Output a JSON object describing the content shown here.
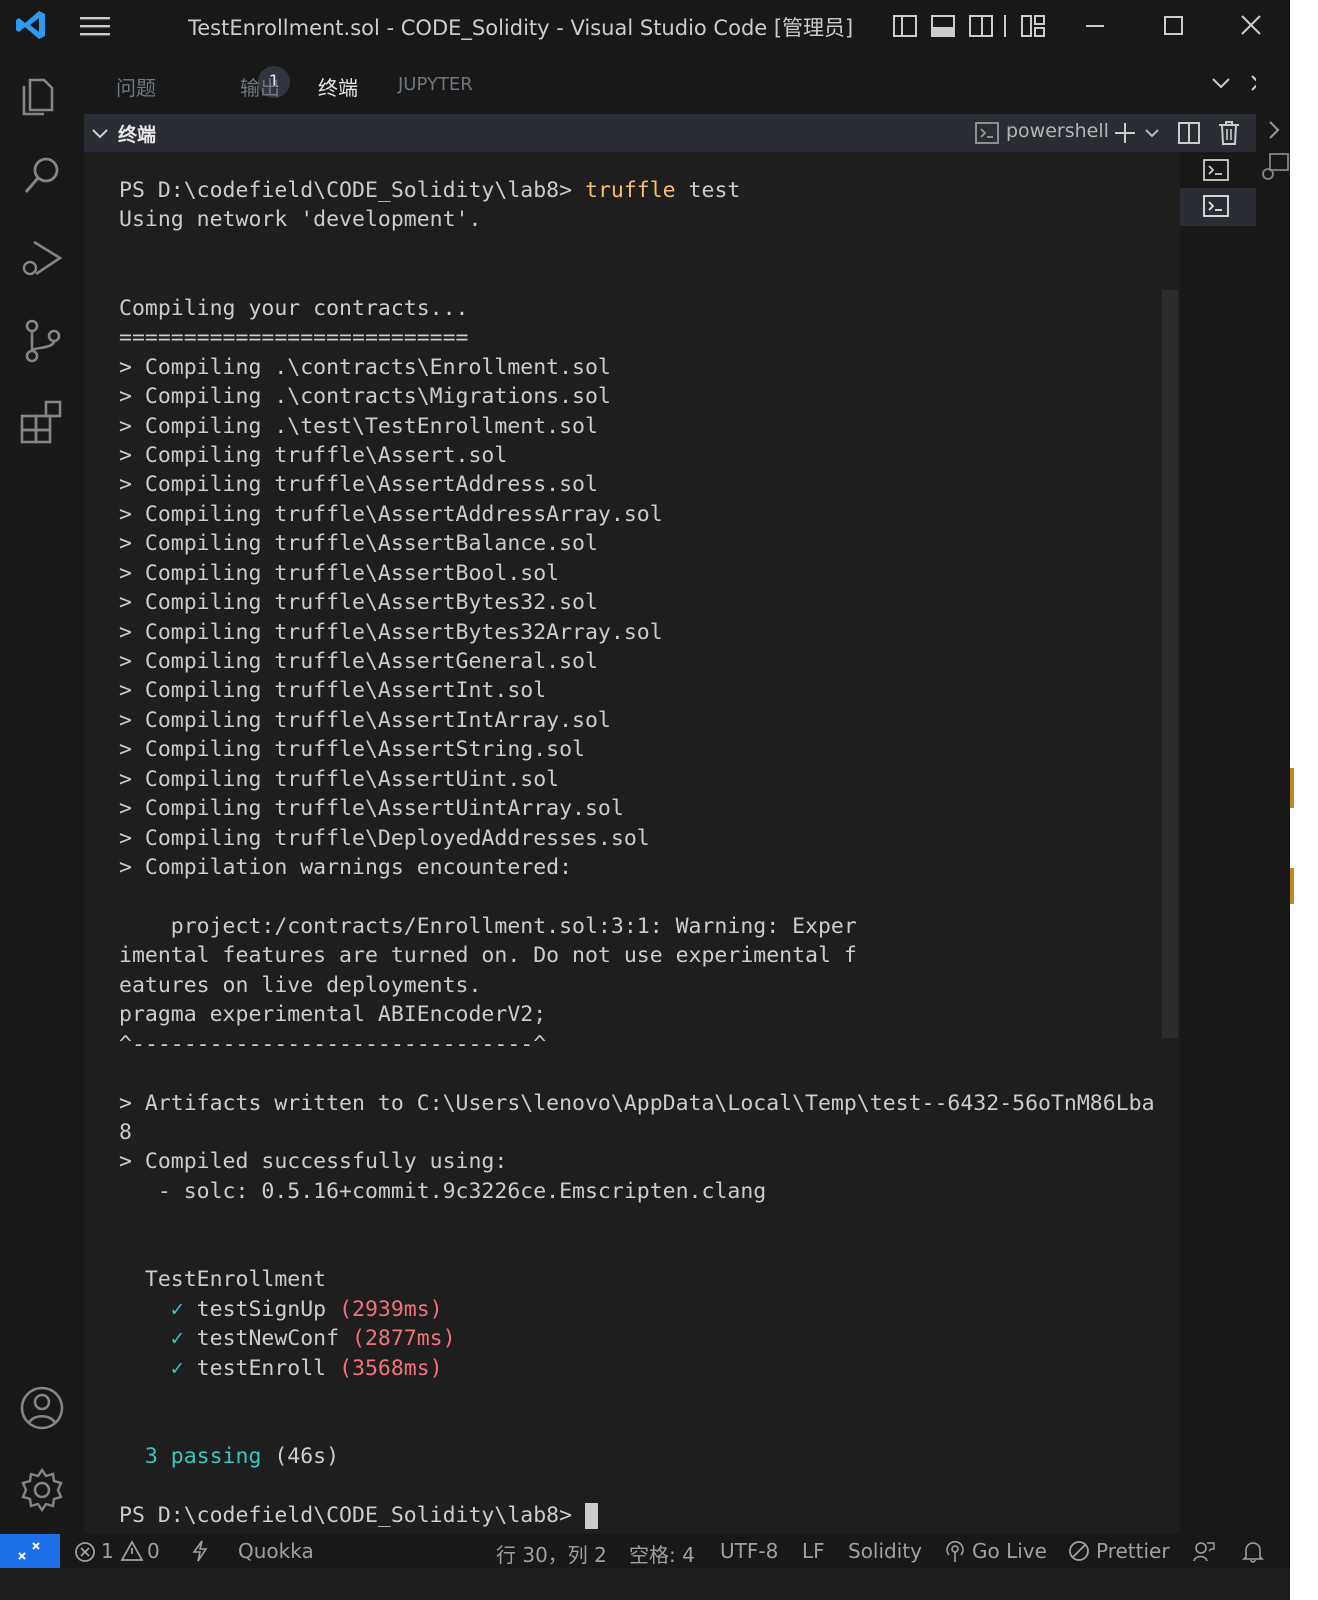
{
  "window": {
    "title": "TestEnrollment.sol - CODE_Solidity - Visual Studio Code [管理员]"
  },
  "panel": {
    "tabs": [
      {
        "label": "问题",
        "badge": "1"
      },
      {
        "label": "输出"
      },
      {
        "label": "终端"
      },
      {
        "label": "JUPYTER"
      }
    ],
    "active_tab": "终端"
  },
  "terminal_header": {
    "title": "终端",
    "shell": "powershell"
  },
  "terminal": {
    "lines": [
      {
        "segments": [
          {
            "t": "PS D:\\codefield\\CODE_Solidity\\lab8> "
          },
          {
            "t": "truffle",
            "c": "y"
          },
          {
            "t": " test"
          }
        ]
      },
      {
        "segments": [
          {
            "t": "Using network 'development'."
          }
        ]
      },
      {
        "segments": [
          {
            "t": ""
          }
        ]
      },
      {
        "segments": [
          {
            "t": ""
          }
        ]
      },
      {
        "segments": [
          {
            "t": "Compiling your contracts..."
          }
        ]
      },
      {
        "segments": [
          {
            "t": "==========================="
          }
        ]
      },
      {
        "segments": [
          {
            "t": "> Compiling .\\contracts\\Enrollment.sol"
          }
        ]
      },
      {
        "segments": [
          {
            "t": "> Compiling .\\contracts\\Migrations.sol"
          }
        ]
      },
      {
        "segments": [
          {
            "t": "> Compiling .\\test\\TestEnrollment.sol"
          }
        ]
      },
      {
        "segments": [
          {
            "t": "> Compiling truffle\\Assert.sol"
          }
        ]
      },
      {
        "segments": [
          {
            "t": "> Compiling truffle\\AssertAddress.sol"
          }
        ]
      },
      {
        "segments": [
          {
            "t": "> Compiling truffle\\AssertAddressArray.sol"
          }
        ]
      },
      {
        "segments": [
          {
            "t": "> Compiling truffle\\AssertBalance.sol"
          }
        ]
      },
      {
        "segments": [
          {
            "t": "> Compiling truffle\\AssertBool.sol"
          }
        ]
      },
      {
        "segments": [
          {
            "t": "> Compiling truffle\\AssertBytes32.sol"
          }
        ]
      },
      {
        "segments": [
          {
            "t": "> Compiling truffle\\AssertBytes32Array.sol"
          }
        ]
      },
      {
        "segments": [
          {
            "t": "> Compiling truffle\\AssertGeneral.sol"
          }
        ]
      },
      {
        "segments": [
          {
            "t": "> Compiling truffle\\AssertInt.sol"
          }
        ]
      },
      {
        "segments": [
          {
            "t": "> Compiling truffle\\AssertIntArray.sol"
          }
        ]
      },
      {
        "segments": [
          {
            "t": "> Compiling truffle\\AssertString.sol"
          }
        ]
      },
      {
        "segments": [
          {
            "t": "> Compiling truffle\\AssertUint.sol"
          }
        ]
      },
      {
        "segments": [
          {
            "t": "> Compiling truffle\\AssertUintArray.sol"
          }
        ]
      },
      {
        "segments": [
          {
            "t": "> Compiling truffle\\DeployedAddresses.sol"
          }
        ]
      },
      {
        "segments": [
          {
            "t": "> Compilation warnings encountered:"
          }
        ]
      },
      {
        "segments": [
          {
            "t": ""
          }
        ]
      },
      {
        "segments": [
          {
            "t": "    project:/contracts/Enrollment.sol:3:1: Warning: Exper"
          }
        ]
      },
      {
        "segments": [
          {
            "t": "imental features are turned on. Do not use experimental f"
          }
        ]
      },
      {
        "segments": [
          {
            "t": "eatures on live deployments."
          }
        ]
      },
      {
        "segments": [
          {
            "t": "pragma experimental ABIEncoderV2;"
          }
        ]
      },
      {
        "segments": [
          {
            "t": "^-------------------------------^"
          }
        ]
      },
      {
        "segments": [
          {
            "t": ""
          }
        ]
      },
      {
        "segments": [
          {
            "t": "> Artifacts written to C:\\Users\\lenovo\\AppData\\Local\\Temp\\test--6432-56oTnM86Lba"
          }
        ]
      },
      {
        "segments": [
          {
            "t": "8"
          }
        ]
      },
      {
        "segments": [
          {
            "t": "> Compiled successfully using:"
          }
        ]
      },
      {
        "segments": [
          {
            "t": "   - solc: 0.5.16+commit.9c3226ce.Emscripten.clang"
          }
        ]
      },
      {
        "segments": [
          {
            "t": ""
          }
        ]
      },
      {
        "segments": [
          {
            "t": ""
          }
        ]
      },
      {
        "segments": [
          {
            "t": "  TestEnrollment"
          }
        ]
      },
      {
        "segments": [
          {
            "t": "    "
          },
          {
            "t": "✓",
            "c": "c"
          },
          {
            "t": " testSignUp "
          },
          {
            "t": "(2939ms)",
            "c": "r"
          }
        ]
      },
      {
        "segments": [
          {
            "t": "    "
          },
          {
            "t": "✓",
            "c": "c"
          },
          {
            "t": " testNewConf "
          },
          {
            "t": "(2877ms)",
            "c": "r"
          }
        ]
      },
      {
        "segments": [
          {
            "t": "    "
          },
          {
            "t": "✓",
            "c": "c"
          },
          {
            "t": " testEnroll "
          },
          {
            "t": "(3568ms)",
            "c": "r"
          }
        ]
      },
      {
        "segments": [
          {
            "t": ""
          }
        ]
      },
      {
        "segments": [
          {
            "t": ""
          }
        ]
      },
      {
        "segments": [
          {
            "t": "  "
          },
          {
            "t": "3 passing",
            "c": "c"
          },
          {
            "t": " (46s)"
          }
        ]
      },
      {
        "segments": [
          {
            "t": ""
          }
        ]
      },
      {
        "segments": [
          {
            "t": "PS D:\\codefield\\CODE_Solidity\\lab8> "
          }
        ],
        "caret": true
      }
    ]
  },
  "statusbar": {
    "errors": "1",
    "warnings": "0",
    "quokka": "Quokka",
    "position": "行 30，列 2",
    "indent": "空格: 4",
    "encoding": "UTF-8",
    "eol": "LF",
    "language": "Solidity",
    "golive": "Go Live",
    "prettier": "Prettier"
  },
  "colors": {
    "accent": "#1f6feb",
    "command_yellow": "#f5c06b",
    "pass_cyan": "#38c6c0",
    "duration_red": "#f3717f"
  },
  "icons": [
    "vscode-logo-icon",
    "menu-icon",
    "files-icon",
    "search-icon",
    "run-debug-icon",
    "source-control-icon",
    "extensions-icon",
    "account-icon",
    "gear-icon",
    "terminal-icon",
    "plus-icon",
    "split-icon",
    "trash-icon",
    "close-icon",
    "chevron-down-icon",
    "bell-icon"
  ]
}
